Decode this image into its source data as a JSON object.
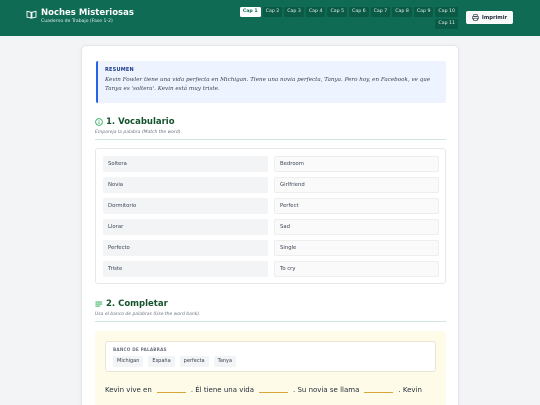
{
  "header": {
    "title": "Noches Misteriosas",
    "subtitle": "Cuaderno de Trabajo (Fase 1-2)",
    "tabs": [
      "Cap 1",
      "Cap 2",
      "Cap 3",
      "Cap 4",
      "Cap 5",
      "Cap 6",
      "Cap 7",
      "Cap 8",
      "Cap 9",
      "Cap 10",
      "Cap 11"
    ],
    "active_tab": "Cap 1",
    "print_label": "Imprimir"
  },
  "summary": {
    "label": "RESUMEN",
    "text": "Kevin Fowler tiene una vida perfecta en Michigan. Tiene una novia perfecta, Tanya. Pero hoy, en Facebook, ve que Tanya es 'soltera'. Kevin está muy triste."
  },
  "vocab": {
    "title": "1. Vocabulario",
    "hint": "Empareja la palabra (Match the word).",
    "spanish": [
      "Soltera",
      "Novia",
      "Dormitorio",
      "Llorar",
      "Perfecto",
      "Triste"
    ],
    "english": [
      "Bedroom",
      "Girlfriend",
      "Perfect",
      "Sad",
      "Single",
      "To cry"
    ]
  },
  "complete": {
    "title": "2. Completar",
    "hint": "Usa el banco de palabras (Use the word bank).",
    "bank_label": "BANCO DE PALABRAS",
    "words": [
      "Michigan",
      "España",
      "perfecta",
      "Tanya"
    ],
    "sentence_parts": [
      "Kevin vive en",
      ". Él tiene una vida",
      ". Su novia se llama",
      ". Kevin"
    ]
  },
  "colors": {
    "header_bg": "#0f6b53",
    "accent_blue": "#2563eb",
    "section_green": "#14532d",
    "fill_bg": "#fefbe8"
  }
}
